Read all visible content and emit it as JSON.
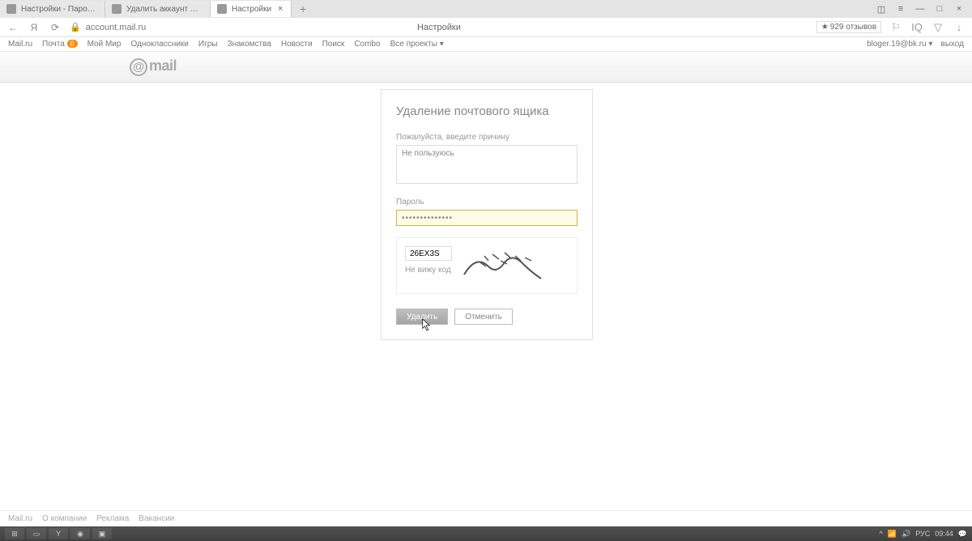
{
  "tabs": [
    {
      "label": "Настройки - Пароль и бе",
      "active": false
    },
    {
      "label": "Удалить аккаунт — Помощ",
      "active": false
    },
    {
      "label": "Настройки",
      "active": true
    }
  ],
  "address": {
    "url": "account.mail.ru",
    "page_title": "Настройки",
    "rating": "929 отзывов"
  },
  "topnav": {
    "links": [
      "Mail.ru",
      "Почта",
      "Мой Мир",
      "Одноклассники",
      "Игры",
      "Знакомства",
      "Новости",
      "Поиск",
      "Combo",
      "Все проекты"
    ],
    "mail_badge": "0",
    "user": "bloger.19@bk.ru",
    "logout": "выход"
  },
  "logo": "mail",
  "card": {
    "title": "Удаление почтового ящика",
    "reason_label": "Пожалуйста, введите причину",
    "reason_value": "Не пользуюсь",
    "password_label": "Пароль",
    "password_value": "••••••••••••••",
    "captcha_value": "26EX3S",
    "captcha_link": "Не вижу код",
    "delete_label": "Удалить",
    "cancel_label": "Отменить"
  },
  "footer": [
    "Mail.ru",
    "О компании",
    "Реклама",
    "Вакансии"
  ],
  "tray": {
    "time": "09:44"
  }
}
